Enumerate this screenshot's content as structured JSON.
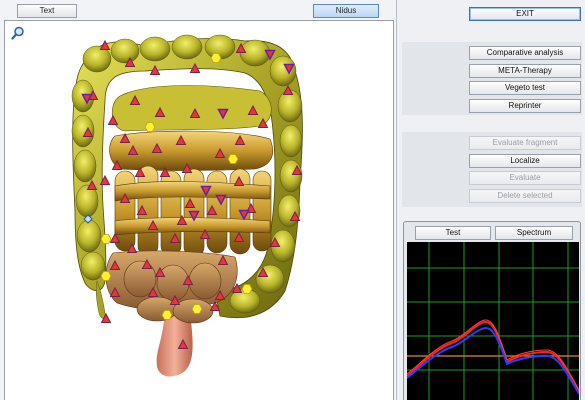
{
  "left_panel": {
    "text_button": "Text",
    "nidus_button": "Nidus",
    "zoom_icon": "magnifier-icon",
    "organ_image": "large-intestine-and-small-intestine"
  },
  "right_panel": {
    "exit_button": "EXIT",
    "analysis_group": [
      "Comparative analysis",
      "META-Therapy",
      "Vegeto test",
      "Reprinter"
    ],
    "fragment_group": [
      {
        "label": "Evaluate fragment",
        "enabled": false
      },
      {
        "label": "Localize",
        "enabled": true
      },
      {
        "label": "Evaluate",
        "enabled": false
      },
      {
        "label": "Delete selected",
        "enabled": false
      }
    ]
  },
  "graph_panel": {
    "tab_test": "Test",
    "tab_spectrum": "Spectrum"
  },
  "colors": {
    "marker_triangle_up": "#e23a2f",
    "marker_triangle_down": "#7a1fa8",
    "marker_hexagon": "#ffee33",
    "graph_grid": "#1f9a1f",
    "graph_red": "#ff2020",
    "graph_blue": "#2a3cff",
    "graph_orange": "#e08a20"
  }
}
